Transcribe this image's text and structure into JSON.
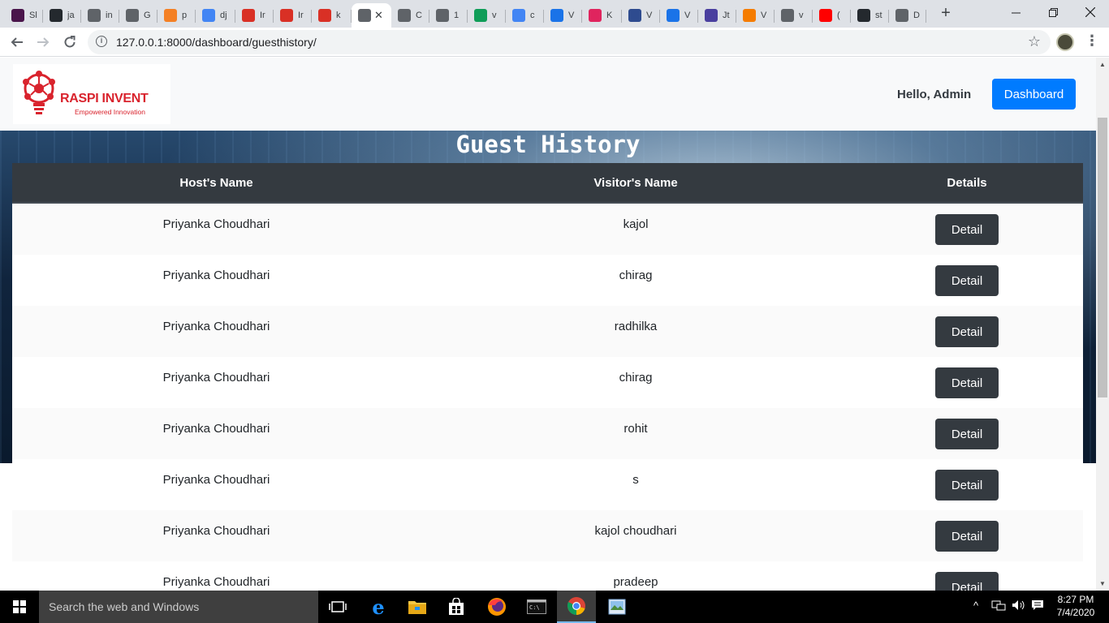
{
  "browser": {
    "tabs": [
      {
        "title": "Sl",
        "icon": "slack-icon",
        "color": "#4a154b"
      },
      {
        "title": "ja",
        "icon": "github-icon",
        "color": "#24292e"
      },
      {
        "title": "in",
        "icon": "globe-icon",
        "color": "#5f6368"
      },
      {
        "title": "G",
        "icon": "globe-icon",
        "color": "#5f6368"
      },
      {
        "title": "p",
        "icon": "stackoverflow-icon",
        "color": "#f48024"
      },
      {
        "title": "dj",
        "icon": "google-icon",
        "color": "#4285f4"
      },
      {
        "title": "Ir",
        "icon": "gmail-icon",
        "color": "#d93025"
      },
      {
        "title": "Ir",
        "icon": "gmail-icon",
        "color": "#d93025"
      },
      {
        "title": "k",
        "icon": "gmail-icon",
        "color": "#d93025"
      },
      {
        "title": "",
        "icon": "globe-icon",
        "color": "#5f6368",
        "active": true
      },
      {
        "title": "C",
        "icon": "globe-icon",
        "color": "#5f6368"
      },
      {
        "title": "1",
        "icon": "globe-icon",
        "color": "#5f6368"
      },
      {
        "title": "v",
        "icon": "google-drive-icon",
        "color": "#0f9d58"
      },
      {
        "title": "c",
        "icon": "google-docs-icon",
        "color": "#4285f4"
      },
      {
        "title": "V",
        "icon": "dots-icon",
        "color": "#1a73e8"
      },
      {
        "title": "K",
        "icon": "quora-icon",
        "color": "#e0245e"
      },
      {
        "title": "V",
        "icon": "r-logo-icon",
        "color": "#2e4b8f"
      },
      {
        "title": "V",
        "icon": "send-arrow-icon",
        "color": "#1a73e8"
      },
      {
        "title": "Jt",
        "icon": "person-icon",
        "color": "#4a3f9f"
      },
      {
        "title": "V",
        "icon": "walker-icon",
        "color": "#f57c00"
      },
      {
        "title": "v",
        "icon": "globe-icon",
        "color": "#5f6368"
      },
      {
        "title": "(",
        "icon": "youtube-icon",
        "color": "#ff0000"
      },
      {
        "title": "st",
        "icon": "github-icon",
        "color": "#24292e"
      },
      {
        "title": "D",
        "icon": "globe-icon",
        "color": "#5f6368"
      }
    ],
    "url": "127.0.0.1:8000/dashboard/guesthistory/"
  },
  "navbar": {
    "brand": "RASPI INVENT",
    "tagline": "Empowered Innovation",
    "greeting": "Hello, Admin",
    "dashboard_label": "Dashboard"
  },
  "page": {
    "title": "Guest History",
    "columns": [
      "Host's Name",
      "Visitor's Name",
      "Details"
    ],
    "detail_label": "Detail",
    "rows": [
      {
        "host": "Priyanka Choudhari",
        "visitor": "kajol"
      },
      {
        "host": "Priyanka Choudhari",
        "visitor": "chirag"
      },
      {
        "host": "Priyanka Choudhari",
        "visitor": "radhilka"
      },
      {
        "host": "Priyanka Choudhari",
        "visitor": "chirag"
      },
      {
        "host": "Priyanka Choudhari",
        "visitor": "rohit"
      },
      {
        "host": "Priyanka Choudhari",
        "visitor": "s"
      },
      {
        "host": "Priyanka Choudhari",
        "visitor": "kajol choudhari"
      },
      {
        "host": "Priyanka Choudhari",
        "visitor": "pradeep"
      }
    ]
  },
  "taskbar": {
    "search_placeholder": "Search the web and Windows",
    "time": "8:27 PM",
    "date": "7/4/2020"
  },
  "colors": {
    "primary": "#007bff",
    "dark": "#343a40",
    "brand_red": "#d9232d"
  }
}
